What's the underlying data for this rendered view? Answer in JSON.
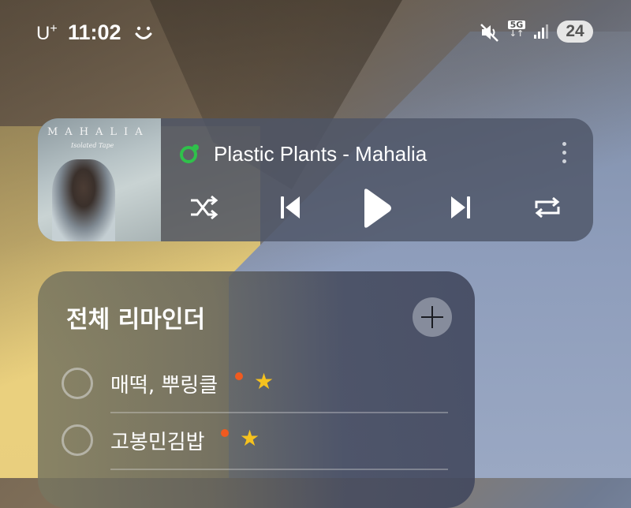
{
  "status_bar": {
    "carrier": "U",
    "carrier_sup": "+",
    "time": "11:02",
    "network_type": "5G",
    "battery": "24"
  },
  "music_widget": {
    "album_artist_text": "MAHALIA",
    "album_sub_text": "Isolated Tape",
    "song_title": "Plastic Plants - Mahalia",
    "app_color": "#2fc14b",
    "controls": [
      "shuffle-icon",
      "previous-icon",
      "play-icon",
      "next-icon",
      "repeat-icon"
    ]
  },
  "reminders_widget": {
    "title": "전체 리마인더",
    "items": [
      {
        "label": "매떡, 뿌링클",
        "has_dot": true,
        "starred": true
      },
      {
        "label": "고봉민김밥",
        "has_dot": true,
        "starred": true
      }
    ],
    "dot_color": "#f05a1f",
    "star_color": "#f6c21e"
  }
}
